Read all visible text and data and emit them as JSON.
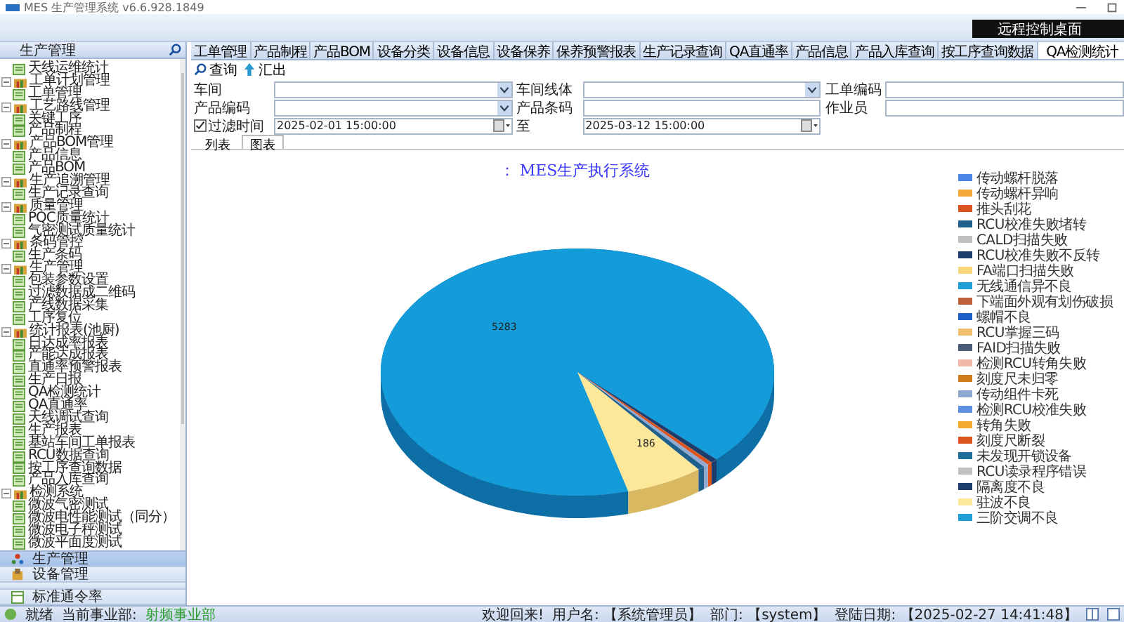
{
  "window": {
    "title": "MES 生产管理系统 v6.6.928.1849"
  },
  "remote_button": "远程控制桌面",
  "sidebar": {
    "title": "生产管理",
    "tree": [
      {
        "label": "天线运维统计"
      },
      {
        "label": "工单计划管理",
        "expanded": true,
        "children": [
          {
            "label": "工单管理"
          }
        ]
      },
      {
        "label": "工艺路线管理",
        "expanded": true,
        "children": [
          {
            "label": "关键工序"
          },
          {
            "label": "产品制程"
          }
        ]
      },
      {
        "label": "产品BOM管理",
        "expanded": true,
        "children": [
          {
            "label": "产品信息"
          },
          {
            "label": "产品BOM"
          }
        ]
      },
      {
        "label": "生产追溯管理",
        "expanded": true,
        "children": [
          {
            "label": "生产记录查询"
          }
        ]
      },
      {
        "label": "质量管理",
        "expanded": true,
        "children": [
          {
            "label": "PQC质量统计"
          },
          {
            "label": "气密测试质量统计"
          }
        ]
      },
      {
        "label": "条码管控",
        "expanded": true,
        "children": [
          {
            "label": "生产条码"
          }
        ]
      },
      {
        "label": "生产管理",
        "expanded": true,
        "children": [
          {
            "label": "包装参数设置"
          },
          {
            "label": "过滤数据成二维码"
          },
          {
            "label": "产线数据采集"
          },
          {
            "label": "工序复位"
          }
        ]
      },
      {
        "label": "统计报表(池厨)",
        "expanded": true,
        "children": [
          {
            "label": "日达成率报表"
          },
          {
            "label": "产能达成报表"
          },
          {
            "label": "直通率预警报表"
          },
          {
            "label": "生产日报"
          },
          {
            "label": "QA检测统计"
          },
          {
            "label": "QA直通率"
          },
          {
            "label": "天线调试查询"
          },
          {
            "label": "生产报表"
          },
          {
            "label": "基站车间工单报表"
          },
          {
            "label": "RCU数据查询"
          },
          {
            "label": "按工序查询数据"
          },
          {
            "label": "产品入库查询"
          }
        ]
      },
      {
        "label": "检测系统",
        "expanded": true,
        "children": [
          {
            "label": "微波气密测试"
          },
          {
            "label": "微波电性能测试（同分）"
          },
          {
            "label": "微波电子秤测试"
          },
          {
            "label": "微波平面度测试"
          }
        ]
      }
    ],
    "nav": [
      {
        "label": "生产管理",
        "selected": true,
        "kind": "people"
      },
      {
        "label": "设备管理",
        "selected": false,
        "kind": "box"
      },
      {
        "label": "标准通令率",
        "selected": false,
        "kind": "table"
      }
    ]
  },
  "tabs": [
    {
      "label": "工单管理",
      "selected": false
    },
    {
      "label": "产品制程",
      "selected": false
    },
    {
      "label": "产品BOM",
      "selected": false
    },
    {
      "label": "设备分类",
      "selected": false
    },
    {
      "label": "设备信息",
      "selected": false
    },
    {
      "label": "设备保养",
      "selected": false
    },
    {
      "label": "保养预警报表",
      "selected": false
    },
    {
      "label": "生产记录查询",
      "selected": false
    },
    {
      "label": "QA直通率",
      "selected": false
    },
    {
      "label": "产品信息",
      "selected": false
    },
    {
      "label": "产品入库查询",
      "selected": false
    },
    {
      "label": "按工序查询数据",
      "selected": false
    },
    {
      "label": "QA检测统计",
      "selected": true
    }
  ],
  "toolbar": [
    {
      "label": "查询",
      "kind": "search"
    },
    {
      "label": "汇出",
      "kind": "export"
    }
  ],
  "form": {
    "rows": [
      [
        {
          "label": "车间",
          "kind": "select"
        },
        {
          "label": "车间线体",
          "kind": "select"
        },
        {
          "label": "工单编码",
          "kind": "input"
        }
      ],
      [
        {
          "label": "产品编码",
          "kind": "select"
        },
        {
          "label": "产品条码",
          "kind": "input"
        },
        {
          "label": "作业员",
          "kind": "input"
        }
      ]
    ],
    "time_filter": {
      "label": "过滤时间",
      "checked": true,
      "from": "2025-02-01 15:00:00",
      "to_label": "至",
      "to": "2025-03-12 15:00:00"
    }
  },
  "view_tabs": [
    {
      "label": "列表",
      "selected": false
    },
    {
      "label": "图表",
      "selected": true
    }
  ],
  "chart": {
    "title": "：  MES生产执行系统",
    "slice_labels": [
      "5283",
      "186"
    ],
    "legend": [
      {
        "label": "传动螺杆脱落",
        "color": "#4a86e8"
      },
      {
        "label": "传动螺杆异响",
        "color": "#f4a83a"
      },
      {
        "label": "推头刮花",
        "color": "#d9541e"
      },
      {
        "label": "RCU校准失败堵转",
        "color": "#1f5f8b"
      },
      {
        "label": "CALD扫描失败",
        "color": "#bfbfbf"
      },
      {
        "label": "RCU校准失败不反转",
        "color": "#1c3d6b"
      },
      {
        "label": "FA端口扫描失败",
        "color": "#f8d77a"
      },
      {
        "label": "无线通信异不良",
        "color": "#1e9fd8"
      },
      {
        "label": "下端面外观有划伤破损",
        "color": "#c0603a"
      },
      {
        "label": "螺帽不良",
        "color": "#1d5fc8"
      },
      {
        "label": "RCU掌握三码",
        "color": "#f0c070"
      },
      {
        "label": "FAID扫描失败",
        "color": "#4a5c7a"
      },
      {
        "label": "检测RCU转角失败",
        "color": "#f2b8a8"
      },
      {
        "label": "刻度尺未归零",
        "color": "#d07a1a"
      },
      {
        "label": "传动组件卡死",
        "color": "#8fa8d0"
      },
      {
        "label": "检测RCU校准失败",
        "color": "#5f8fe0"
      },
      {
        "label": "转角失败",
        "color": "#f4a830"
      },
      {
        "label": "刻度尺断裂",
        "color": "#d9541e"
      },
      {
        "label": "未发现开锁设备",
        "color": "#1f6f9b"
      },
      {
        "label": "RCU读录程序错误",
        "color": "#c0c0c0"
      },
      {
        "label": "隔离度不良",
        "color": "#1c3d6b"
      },
      {
        "label": "驻波不良",
        "color": "#fde89a"
      },
      {
        "label": "三阶交调不良",
        "color": "#1e9fd8"
      }
    ]
  },
  "status_bar": {
    "state": "就绪",
    "unit_label": "当前事业部:",
    "unit": "射频事业部",
    "welcome": "欢迎回来!",
    "user": "用户名: 【系统管理员】",
    "dept": "部门: 【system】",
    "login": "登陆日期: 【2025-02-27 14:41:48】"
  }
}
